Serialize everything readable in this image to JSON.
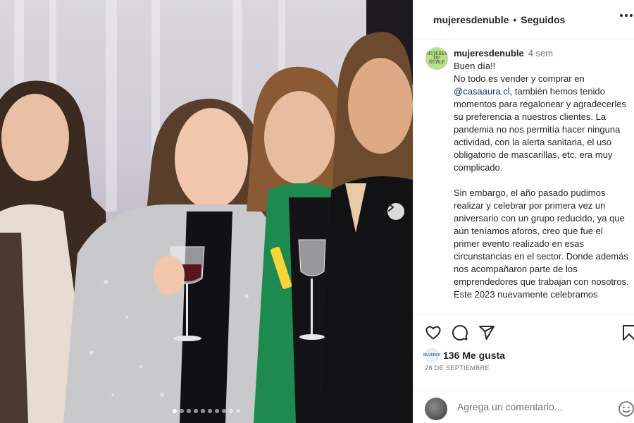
{
  "post": {
    "username": "mujeresdenuble",
    "follow_status": "Seguidos",
    "separator": "•",
    "avatar_logo_text": "MUJERES DE ÑUBLE"
  },
  "caption": {
    "username": "mujeresdenuble",
    "time": "4 sem",
    "line1": "Buen día!!",
    "p1_pre": "No todo es vender y comprar en ",
    "mention": "@casaaura.cl",
    "p1_post": ", también hemos tenido momentos para regalonear y agradecerles su preferencia a nuestros clientes. La pandemia no nos permitía hacer ninguna actividad, con la alerta sanitaria, el uso obligatorio de mascarillas, etc. era muy complicado.",
    "p2": "Sin embargo, el año pasado pudimos realizar y celebrar por primera vez un aniversario con un grupo reducido, ya que aún teníamos aforos, creo que fue el primer evento realizado en esas circunstancias en el sector. Donde además nos acompañaron parte de los emprendedores que trabajan con nosotros.",
    "p3": "Este 2023 nuevamente celebramos"
  },
  "engagement": {
    "likes": "136 Me gusta",
    "date": "28 DE SEPTIEMBRE",
    "liker_avatar_text": "MUJERES"
  },
  "comment": {
    "placeholder": "Agrega un comentario..."
  },
  "carousel": {
    "slide_count": 10,
    "active_index": 0
  },
  "icons": [
    "heart-icon",
    "comment-icon",
    "share-icon",
    "bookmark-icon",
    "more-options-icon",
    "emoji-icon",
    "chevron-right-icon"
  ]
}
